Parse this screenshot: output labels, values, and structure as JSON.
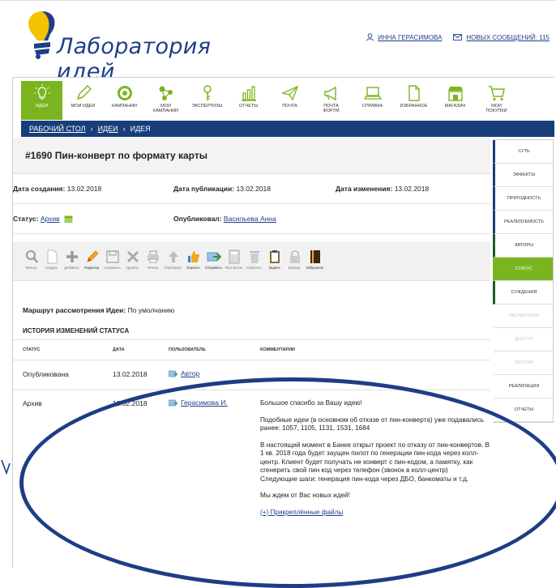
{
  "header": {
    "logo_text": "Лаборатория идей",
    "user_name": "ИННА ГЕРАСИМОВА",
    "messages": "НОВЫХ СООБЩЕНИЙ: 115"
  },
  "nav": {
    "items": [
      {
        "label": "ИДЕИ",
        "icon": "lightbulb-icon",
        "active": true
      },
      {
        "label": "МОИ ИДЕИ",
        "icon": "pencil-icon"
      },
      {
        "label": "КАМПАНИИ",
        "icon": "target-icon"
      },
      {
        "label": "МОИ КАМПАНИИ",
        "icon": "molecule-icon"
      },
      {
        "label": "ЭКСПЕРТИЗЫ",
        "icon": "key-icon"
      },
      {
        "label": "ОТЧЕТЫ",
        "icon": "bar-chart-icon"
      },
      {
        "label": "ПОЧТА",
        "icon": "paper-plane-icon"
      },
      {
        "label": "ПОЧТА ФОРУМ",
        "icon": "megaphone-icon"
      },
      {
        "label": "СПРАВКА",
        "icon": "laptop-icon"
      },
      {
        "label": "ИЗБРАННОЕ",
        "icon": "document-icon"
      },
      {
        "label": "МАГАЗИН",
        "icon": "shop-icon"
      },
      {
        "label": "МОИ ПОКУПКИ",
        "icon": "cart-icon"
      }
    ]
  },
  "breadcrumb": {
    "home": "РАБОЧИЙ СТОЛ",
    "sep": "›",
    "ideas": "ИДЕИ",
    "current": "ИДЕЯ"
  },
  "idea": {
    "title": "#1690 Пин-конверт по формату карты",
    "created_label": "Дата создания:",
    "created": "13.02.2018",
    "published_label": "Дата публикации:",
    "published": "13.02.2018",
    "changed_label": "Дата изменения:",
    "changed": "13.02.2018",
    "status_label": "Статус:",
    "status": "Архив",
    "publisher_label": "Опубликовал:",
    "publisher": "Васильева Анна"
  },
  "toolbar": [
    {
      "label": "Фильтр",
      "icon": "search-icon",
      "enabled": false
    },
    {
      "label": "Создать",
      "icon": "new-doc-icon",
      "enabled": false
    },
    {
      "label": "Добавить",
      "icon": "plus-icon",
      "enabled": false
    },
    {
      "label": "Редактир.",
      "icon": "pencil-icon",
      "enabled": true
    },
    {
      "label": "Сохранить",
      "icon": "save-icon",
      "enabled": false
    },
    {
      "label": "Удалить",
      "icon": "delete-icon",
      "enabled": false
    },
    {
      "label": "Печать",
      "icon": "print-icon",
      "enabled": false
    },
    {
      "label": "Опубликов.",
      "icon": "publish-icon",
      "enabled": false
    },
    {
      "label": "Оценить",
      "icon": "thumbs-up-icon",
      "enabled": true
    },
    {
      "label": "Отправить",
      "icon": "send-icon",
      "enabled": true
    },
    {
      "label": "Рассчитать",
      "icon": "calculator-icon",
      "enabled": false
    },
    {
      "label": "Сбросить",
      "icon": "trash-icon",
      "enabled": false
    },
    {
      "label": "Задача",
      "icon": "clipboard-icon",
      "enabled": true
    },
    {
      "label": "Блокир.",
      "icon": "lock-icon",
      "enabled": false
    },
    {
      "label": "Избранное",
      "icon": "bookmark-icon",
      "enabled": true
    }
  ],
  "route": {
    "label": "Маршрут рассмотрения Идеи:",
    "value": "По умолчанию"
  },
  "history": {
    "title": "ИСТОРИЯ ИЗМЕНЕНИЙ СТАТУСА",
    "columns": [
      "СТАТУС",
      "ДАТА",
      "ПОЛЬЗОВАТЕЛЬ",
      "КОММЕНТАРИИ"
    ],
    "rows": [
      {
        "status": "Опубликована",
        "date": "13.02.2018",
        "user": "Автор",
        "comment": []
      },
      {
        "status": "Архив",
        "date": "13.02.2018",
        "user": "Герасимова И.",
        "comment": [
          "Большое спасибо за Вашу идею!",
          "Подобные идеи (в основном об отказе от пин-конверта) уже подавались ранее: 1057, 1105, 1131, 1531, 1684",
          "В настоящий момент в Банке открыт проект по отказу от пин-конвертов. В 1 кв. 2018 года будет заущен пилот по генерации пин-кода через колл-центр. Клиент будет получать не конверт с пин-кодом, а памятку, как сгенерить свой пин код через телефон (звонок в колл-центр)\nСледующие шаги: генерация пин-кода через ДБО, банкоматы и т.д.",
          "Мы ждем от Вас новых идей!"
        ],
        "attachments": "(+) Прикреплённые файлы"
      }
    ]
  },
  "sidebar": [
    {
      "label": "СУТЬ",
      "style": "blue"
    },
    {
      "label": "ЭФФЕКТЫ",
      "style": "blue"
    },
    {
      "label": "ПРИГОДНОСТЬ",
      "style": "blue"
    },
    {
      "label": "РЕАЛИЗУЕМОСТЬ",
      "style": "blue"
    },
    {
      "label": "АВТОРЫ",
      "style": "green"
    },
    {
      "label": "СТАТУС",
      "style": "active"
    },
    {
      "label": "СУЖДЕНИЯ",
      "style": "green"
    },
    {
      "label": "ЭКСПЕРТИЗЫ",
      "style": "disabled"
    },
    {
      "label": "ДОСТУП",
      "style": "disabled"
    },
    {
      "label": "ВЕРСИИ",
      "style": "disabled"
    },
    {
      "label": "РЕАЛИЗАЦИЯ",
      "style": "plain"
    },
    {
      "label": "ОТЧЕТЫ",
      "style": "plain"
    }
  ],
  "colors": {
    "brand_blue": "#1d3f8a",
    "nav_green": "#7ab520",
    "breadcrumb_bg": "#173d7a"
  }
}
